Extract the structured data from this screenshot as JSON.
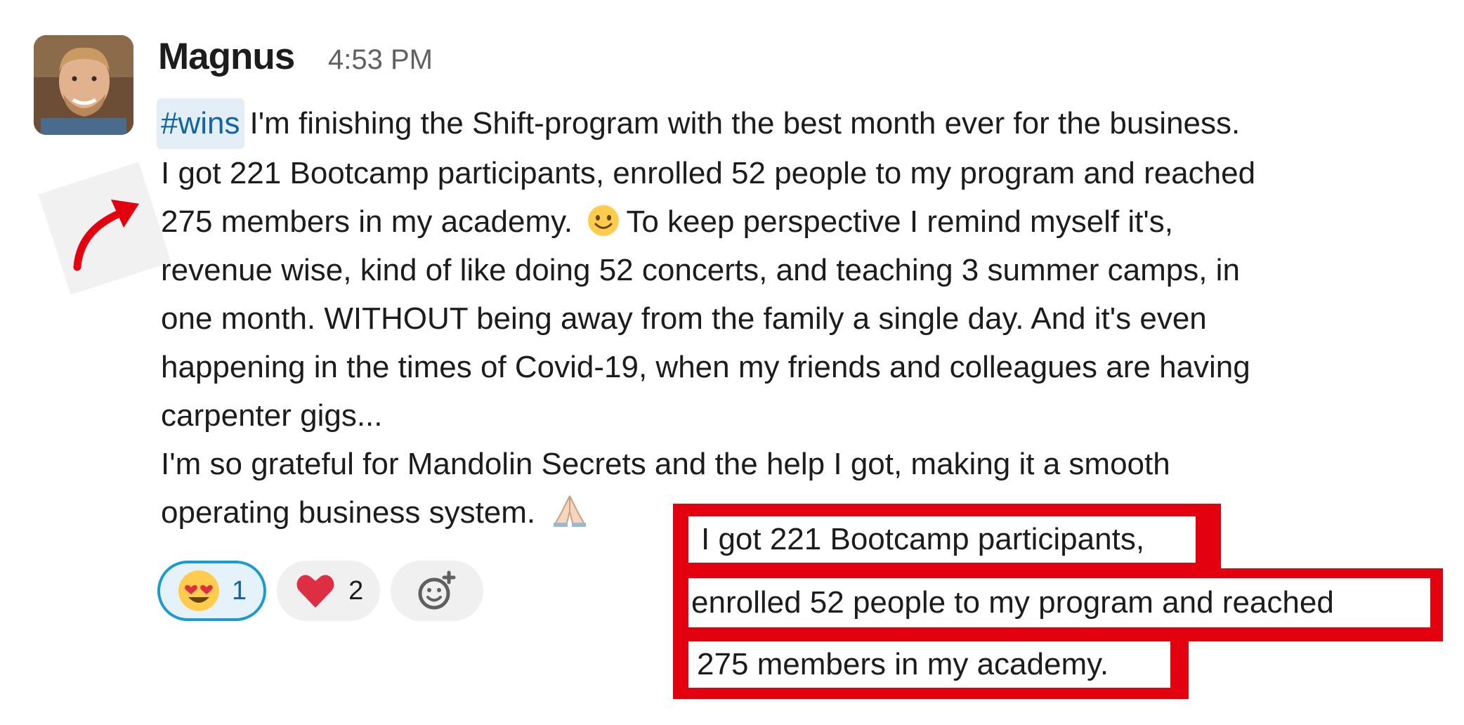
{
  "message": {
    "author": "Magnus",
    "timestamp": "4:53 PM",
    "channel_tag": "#wins",
    "lines": [
      "I'm finishing the Shift-program with the best month ever for the business.",
      "I got 221 Bootcamp participants, enrolled 52 people to my program and reached",
      "275 members in my academy.",
      "To keep perspective I remind myself it's,",
      "revenue wise, kind of like doing 52 concerts, and teaching 3 summer camps, in",
      "one month. WITHOUT being away from the family a single day. And it's even",
      "happening in the times of Covid-19, when my friends and colleagues are having",
      "carpenter gigs...",
      "I'm so grateful for Mandolin Secrets and the help I got, making it a smooth",
      "operating business system."
    ],
    "emoji_smile": "slightly-smiling-face",
    "emoji_pray": "folded-hands"
  },
  "reactions": [
    {
      "emoji": "heart-eyes-face",
      "count": "1",
      "selected": true
    },
    {
      "emoji": "red-heart",
      "count": "2",
      "selected": false
    }
  ],
  "add_reaction_icon": "add-reaction-icon",
  "callouts": [
    "I got 221 Bootcamp participants,",
    "enrolled 52 people to my program and reached",
    "275 members in my academy."
  ],
  "colors": {
    "accent_red": "#e3000f",
    "channel_blue": "#1264a3",
    "reaction_border": "#1d9bd1"
  }
}
